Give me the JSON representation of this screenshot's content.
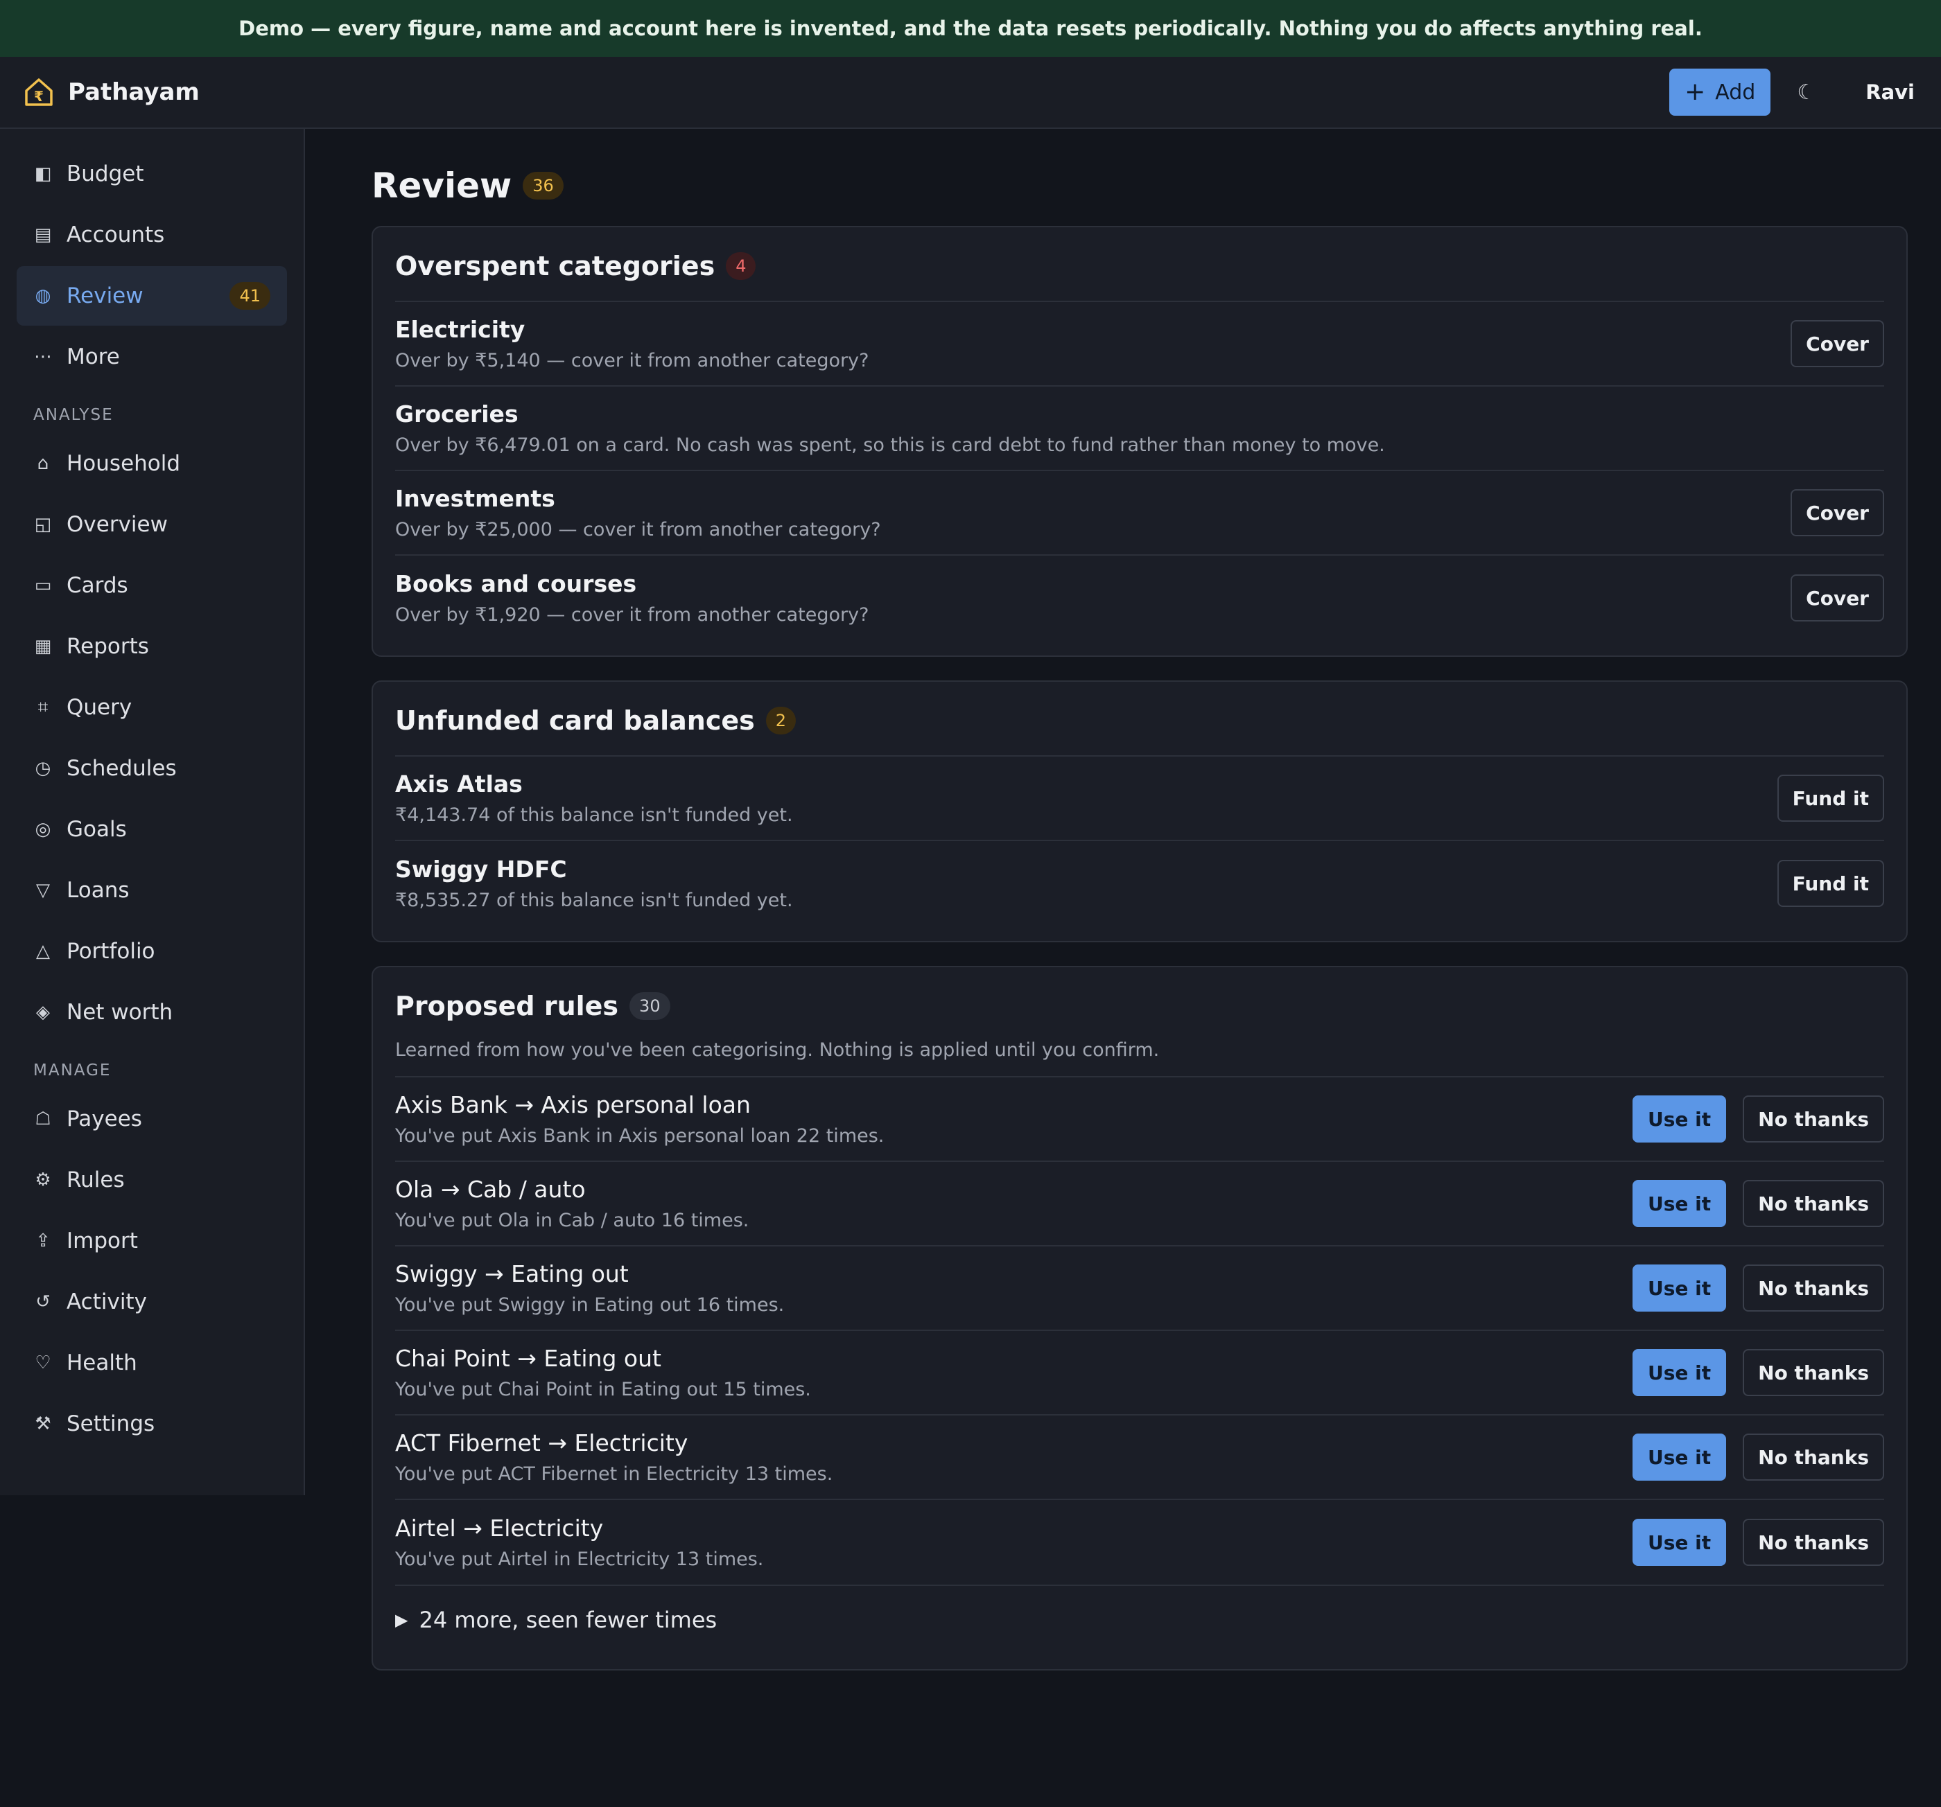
{
  "banner": "Demo — every figure, name and account here is invented, and the data resets periodically. Nothing you do affects anything real.",
  "brand": {
    "name": "Pathayam",
    "logo_icon": "rupee-house-icon"
  },
  "topbar": {
    "add_label": "Add",
    "add_icon": "+",
    "theme_icon": "☾",
    "user": "Ravi"
  },
  "sidebar": {
    "primary": [
      {
        "key": "budget",
        "icon": "◧",
        "label": "Budget"
      },
      {
        "key": "accounts",
        "icon": "▤",
        "label": "Accounts"
      },
      {
        "key": "review",
        "icon": "◍",
        "label": "Review",
        "badge": "41",
        "active": true
      },
      {
        "key": "more",
        "icon": "⋯",
        "label": "More"
      }
    ],
    "analyse_heading": "ANALYSE",
    "analyse": [
      {
        "key": "household",
        "icon": "⌂",
        "label": "Household"
      },
      {
        "key": "overview",
        "icon": "◱",
        "label": "Overview"
      },
      {
        "key": "cards",
        "icon": "▭",
        "label": "Cards"
      },
      {
        "key": "reports",
        "icon": "▦",
        "label": "Reports"
      },
      {
        "key": "query",
        "icon": "⌗",
        "label": "Query"
      },
      {
        "key": "schedules",
        "icon": "◷",
        "label": "Schedules"
      },
      {
        "key": "goals",
        "icon": "◎",
        "label": "Goals"
      },
      {
        "key": "loans",
        "icon": "▽",
        "label": "Loans"
      },
      {
        "key": "portfolio",
        "icon": "△",
        "label": "Portfolio"
      },
      {
        "key": "net-worth",
        "icon": "◈",
        "label": "Net worth"
      }
    ],
    "manage_heading": "MANAGE",
    "manage": [
      {
        "key": "payees",
        "icon": "☖",
        "label": "Payees"
      },
      {
        "key": "rules",
        "icon": "⚙",
        "label": "Rules"
      },
      {
        "key": "import",
        "icon": "⇪",
        "label": "Import"
      },
      {
        "key": "activity",
        "icon": "↺",
        "label": "Activity"
      },
      {
        "key": "health",
        "icon": "♡",
        "label": "Health"
      },
      {
        "key": "settings",
        "icon": "⚒",
        "label": "Settings"
      }
    ]
  },
  "page": {
    "title": "Review",
    "count": "36"
  },
  "overspent": {
    "title": "Overspent categories",
    "count": "4",
    "rows": [
      {
        "name": "Electricity",
        "desc": "Over by ₹5,140 — cover it from another category?",
        "action": "Cover"
      },
      {
        "name": "Groceries",
        "desc": "Over by ₹6,479.01 on a card. No cash was spent, so this is card debt to fund rather than money to move.",
        "action": ""
      },
      {
        "name": "Investments",
        "desc": "Over by ₹25,000 — cover it from another category?",
        "action": "Cover"
      },
      {
        "name": "Books and courses",
        "desc": "Over by ₹1,920 — cover it from another category?",
        "action": "Cover"
      }
    ]
  },
  "unfunded": {
    "title": "Unfunded card balances",
    "count": "2",
    "rows": [
      {
        "name": "Axis Atlas",
        "desc": "₹4,143.74 of this balance isn't funded yet.",
        "action": "Fund it"
      },
      {
        "name": "Swiggy HDFC",
        "desc": "₹8,535.27 of this balance isn't funded yet.",
        "action": "Fund it"
      }
    ]
  },
  "rules": {
    "title": "Proposed rules",
    "count": "30",
    "subtitle": "Learned from how you've been categorising. Nothing is applied until you confirm.",
    "accept_label": "Use it",
    "reject_label": "No thanks",
    "rows": [
      {
        "name": "Axis Bank → Axis personal loan",
        "desc": "You've put Axis Bank in Axis personal loan 22 times."
      },
      {
        "name": "Ola → Cab / auto",
        "desc": "You've put Ola in Cab / auto 16 times."
      },
      {
        "name": "Swiggy → Eating out",
        "desc": "You've put Swiggy in Eating out 16 times."
      },
      {
        "name": "Chai Point → Eating out",
        "desc": "You've put Chai Point in Eating out 15 times."
      },
      {
        "name": "ACT Fibernet → Electricity",
        "desc": "You've put ACT Fibernet in Electricity 13 times."
      },
      {
        "name": "Airtel → Electricity",
        "desc": "You've put Airtel in Electricity 13 times."
      }
    ],
    "more_label": "24 more, seen fewer times"
  },
  "colors": {
    "accent": "#5b96e6",
    "banner_bg": "#173a2a",
    "badge_amber": "#f2c14e",
    "badge_red": "#ee6a6a"
  }
}
